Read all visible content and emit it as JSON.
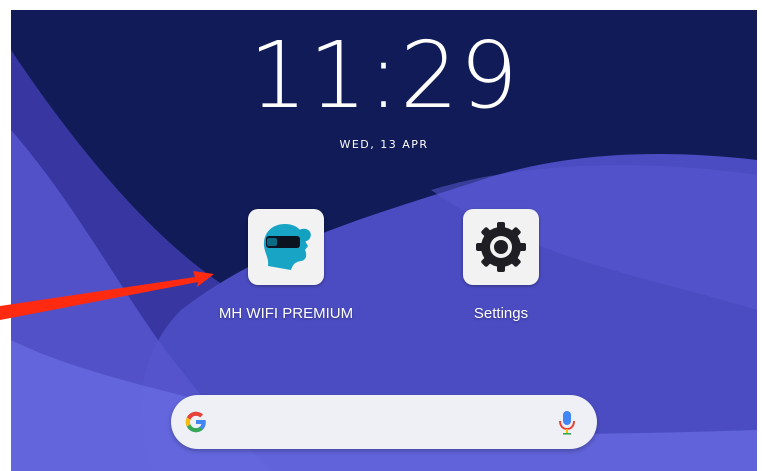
{
  "lockscreen": {
    "time": "11:29",
    "date": "WED, 13 APR"
  },
  "apps": [
    {
      "label": "MH WIFI PREMIUM",
      "icon": "head-vr-headset-icon"
    },
    {
      "label": "Settings",
      "icon": "gear-icon"
    }
  ],
  "search": {
    "placeholder": "",
    "left_icon": "google-g-icon",
    "right_icon": "microphone-icon"
  },
  "annotation": {
    "arrow_color": "#ff2a10"
  },
  "colors": {
    "wallpaper_dark": "#101c55",
    "wallpaper_mid": "#4a4bbf",
    "wallpaper_light": "#6b6fe0"
  }
}
